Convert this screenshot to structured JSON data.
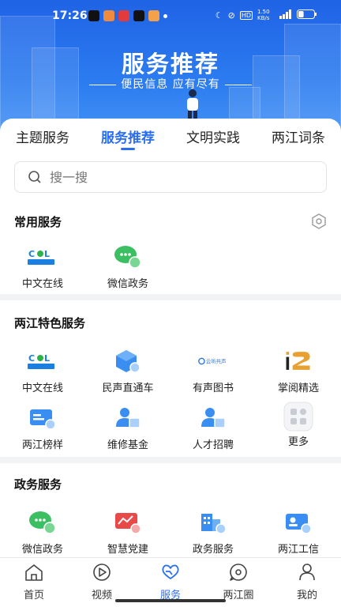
{
  "status_bar": {
    "time": "17:26",
    "network_speed": "1.50 KB/s",
    "battery_level": 0.35
  },
  "hero": {
    "title": "服务推荐",
    "subtitle": "便民信息 应有尽有"
  },
  "tabs": [
    {
      "label": "主题服务",
      "active": false
    },
    {
      "label": "服务推荐",
      "active": true
    },
    {
      "label": "文明实践",
      "active": false
    },
    {
      "label": "两江词条",
      "active": false
    }
  ],
  "search": {
    "placeholder": "搜一搜"
  },
  "common": {
    "title": "常用服务",
    "items": [
      {
        "label": "中文在线",
        "icon": "col-logo-icon"
      },
      {
        "label": "微信政务",
        "icon": "wechat-icon"
      }
    ]
  },
  "featured": {
    "title": "两江特色服务",
    "items": [
      {
        "label": "中文在线",
        "icon": "col-logo-icon"
      },
      {
        "label": "民声直通车",
        "icon": "cube-icon"
      },
      {
        "label": "有声图书",
        "icon": "audiobook-logo-icon",
        "logo_text": "云听共声"
      },
      {
        "label": "掌阅精选",
        "icon": "ireader-logo-icon"
      },
      {
        "label": "两江榜样",
        "icon": "id-card-icon"
      },
      {
        "label": "维修基金",
        "icon": "user-card-icon"
      },
      {
        "label": "人才招聘",
        "icon": "user-card-icon"
      },
      {
        "label": "更多",
        "icon": "grid-more-icon"
      }
    ]
  },
  "gov": {
    "title": "政务服务",
    "items": [
      {
        "label": "微信政务",
        "icon": "wechat-icon"
      },
      {
        "label": "智慧党建",
        "icon": "party-icon"
      },
      {
        "label": "政务服务",
        "icon": "building-icon"
      },
      {
        "label": "两江工信",
        "icon": "profile-edit-icon"
      }
    ]
  },
  "nav": [
    {
      "label": "首页",
      "icon": "home-icon",
      "active": false
    },
    {
      "label": "视频",
      "icon": "play-icon",
      "active": false
    },
    {
      "label": "服务",
      "icon": "heart-hands-icon",
      "active": true
    },
    {
      "label": "两江圈",
      "icon": "chat-circle-icon",
      "active": false
    },
    {
      "label": "我的",
      "icon": "person-icon",
      "active": false
    }
  ],
  "colors": {
    "accent": "#2b6ff0",
    "hero": "#1f63e6"
  }
}
